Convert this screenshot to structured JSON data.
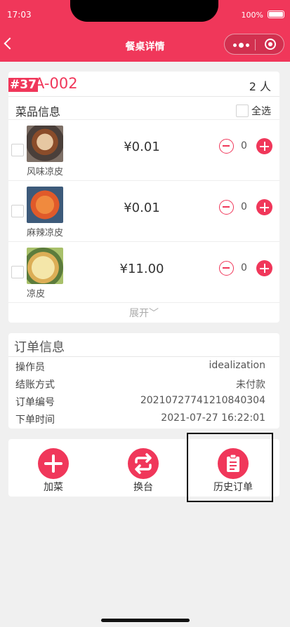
{
  "status_bar": {
    "time": "17:03",
    "battery": "100%"
  },
  "nav": {
    "title": "餐桌详情"
  },
  "table": {
    "order_tag": "#37",
    "code": "A-002",
    "guests": "2 人"
  },
  "dishes_section": {
    "title": "菜品信息",
    "select_all": "全选",
    "expand": "展开﹀"
  },
  "dishes": [
    {
      "name": "风味凉皮",
      "price": "¥0.01",
      "qty": "0"
    },
    {
      "name": "麻辣凉皮",
      "price": "¥0.01",
      "qty": "0"
    },
    {
      "name": "凉皮",
      "price": "¥11.00",
      "qty": "0"
    }
  ],
  "order_info": {
    "title": "订单信息",
    "rows": [
      {
        "label": "操作员",
        "value": "idealization"
      },
      {
        "label": "结账方式",
        "value": "未付款"
      },
      {
        "label": "订单编号",
        "value": "20210727741210840304"
      },
      {
        "label": "下单时间",
        "value": "2021-07-27 16:22:01"
      }
    ]
  },
  "actions": [
    {
      "label": "加菜",
      "icon": "plus-icon"
    },
    {
      "label": "换台",
      "icon": "swap-icon"
    },
    {
      "label": "历史订单",
      "icon": "clipboard-icon"
    }
  ],
  "colors": {
    "accent": "#f0375a",
    "background": "#f0f0f0"
  }
}
